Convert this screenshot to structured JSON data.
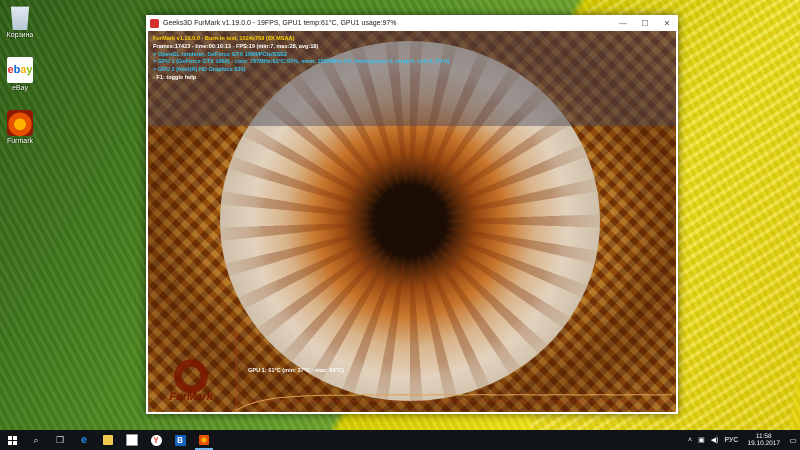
{
  "desktop": {
    "icons": [
      {
        "label": "Корзина",
        "icon": "recycle-bin-icon"
      },
      {
        "label": "eBay",
        "logo_letters": [
          "e",
          "b",
          "a",
          "y"
        ],
        "icon": "ebay-icon"
      },
      {
        "label": "Furmark",
        "icon": "furmark-icon"
      }
    ]
  },
  "window": {
    "title": "Geeks3D FurMark v1.19.0.0 - 19FPS, GPU1 temp:61°C, GPU1 usage:97%",
    "controls": {
      "minimize": "—",
      "maximize": "☐",
      "close": "✕"
    }
  },
  "hud": {
    "line1": "FurMark v1.19.0.0 - Burn-in test, 1024x768 (0X MSAA)",
    "line2": "Frames:17423 - time:00:16:13 - FPS:19 (min:7, max:28, avg:18)",
    "line3": "> OpenGL renderer: GeForce GTX 1060/PCIe/SSE2",
    "line4": "> GPU 1 (GeForce GTX 1060) - core: 797MHz:61°C:97%, mem: 2505MHz:1%, limits(power:0, temp:0, volt:0, OV:0)",
    "line5": "> GPU 2 (Intel(R) HD Graphics 630)",
    "line6": "- F1: toggle help"
  },
  "graph": {
    "label": "GPU 1: 61°C (min: 37°C - max: 64°C)",
    "min_temp": 37,
    "max_temp": 64,
    "current_temp": 61,
    "line_color": "#e0a050"
  },
  "logo": {
    "text": "FurMark"
  },
  "taskbar": {
    "apps": [
      {
        "name": "search-icon",
        "glyph": "⌕"
      },
      {
        "name": "task-view-icon",
        "glyph": "❐"
      },
      {
        "name": "edge-icon",
        "glyph": "e",
        "color": "#1e88e5"
      },
      {
        "name": "file-explorer-icon",
        "color": "#f2c94c"
      },
      {
        "name": "store-icon",
        "color": "#ffffff"
      },
      {
        "name": "yandex-browser-icon",
        "glyph": "Y",
        "color": "#e53935"
      },
      {
        "name": "bandicam-icon",
        "glyph": "B",
        "color": "#1565c0"
      },
      {
        "name": "furmark-taskbar-icon",
        "color": "#e65100",
        "active": true
      }
    ],
    "tray": {
      "language": "РУС",
      "time": "11:58",
      "date": "19.10.2017"
    }
  },
  "colors": {
    "hud_title": "#ffd400",
    "hud_info": "#33c3f0",
    "taskbar": "#111417"
  }
}
